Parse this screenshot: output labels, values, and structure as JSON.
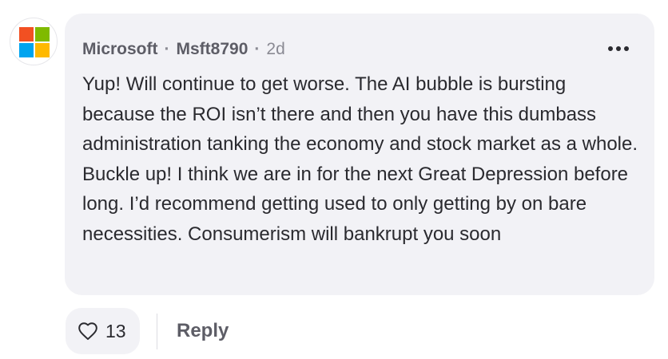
{
  "comment": {
    "author": "Microsoft",
    "separator": "·",
    "handle": "Msft8790",
    "time": "2d",
    "more_icon": "more-horizontal-icon",
    "body": "Yup! Will continue to get worse. The AI bubble is bursting because the ROI isn’t there and then you have this dumbass administration tanking the economy and stock market as a whole. Buckle up! I think we are in for the next Great Depression before long. I’d recommend getting used to only getting by on bare necessities. Consumerism will bankrupt you soon"
  },
  "avatar": {
    "logo": "microsoft-logo",
    "colors": [
      "#f25022",
      "#7fba00",
      "#00a4ef",
      "#ffb900"
    ]
  },
  "actions": {
    "like_icon": "heart-icon",
    "like_count": "13",
    "reply_label": "Reply"
  },
  "theme": {
    "bubble_bg": "#f2f2f6",
    "text": "#2a2a2f",
    "muted": "#5d5d66"
  }
}
